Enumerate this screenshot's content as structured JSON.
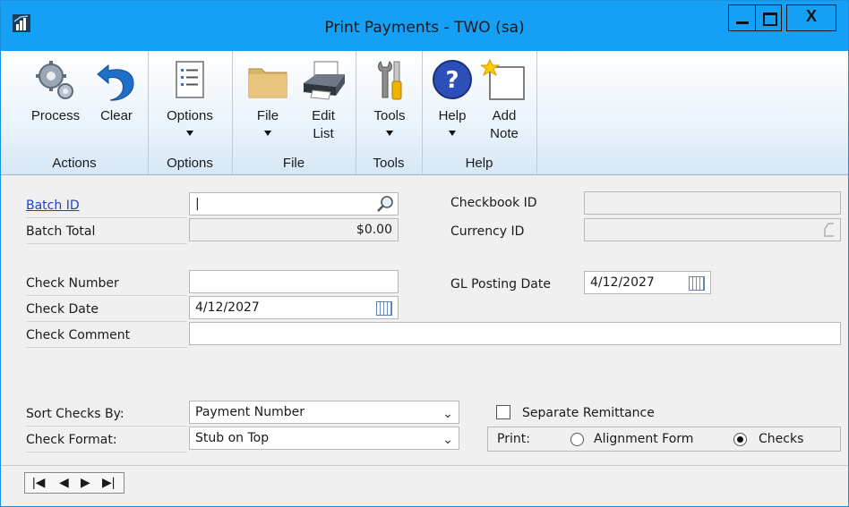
{
  "window": {
    "title": "Print Payments  -  TWO (sa)",
    "close_label": "X"
  },
  "ribbon": {
    "groups": [
      {
        "name": "Actions"
      },
      {
        "name": "Options"
      },
      {
        "name": "File"
      },
      {
        "name": "Tools"
      },
      {
        "name": "Help"
      }
    ],
    "buttons": {
      "process": "Process",
      "clear": "Clear",
      "options": "Options",
      "file": "File",
      "edit_list": "Edit\nList",
      "tools": "Tools",
      "help": "Help",
      "add_note": "Add\nNote"
    }
  },
  "form": {
    "batch_id": {
      "label": "Batch ID",
      "value": "|"
    },
    "batch_total": {
      "label": "Batch Total",
      "value": "$0.00"
    },
    "checkbook_id": {
      "label": "Checkbook ID",
      "value": ""
    },
    "currency_id": {
      "label": "Currency ID",
      "value": ""
    },
    "check_number": {
      "label": "Check Number",
      "value": ""
    },
    "check_date": {
      "label": "Check Date",
      "value": "4/12/2027"
    },
    "gl_posting_date": {
      "label": "GL Posting Date",
      "value": "4/12/2027"
    },
    "check_comment": {
      "label": "Check Comment",
      "value": ""
    },
    "sort_checks_by": {
      "label": "Sort Checks By:",
      "value": "Payment Number"
    },
    "check_format": {
      "label": "Check Format:",
      "value": "Stub on Top"
    },
    "separate_remittance": {
      "label": "Separate Remittance",
      "checked": false
    },
    "print": {
      "label": "Print:",
      "options": [
        "Alignment Form",
        "Checks"
      ],
      "selected": "Checks"
    }
  },
  "navigation": {
    "first": "|◀",
    "prev": "◀",
    "next": "▶",
    "last": "▶|"
  },
  "colors": {
    "titlebar": "#15a0f5",
    "link": "#1c3fd4"
  }
}
